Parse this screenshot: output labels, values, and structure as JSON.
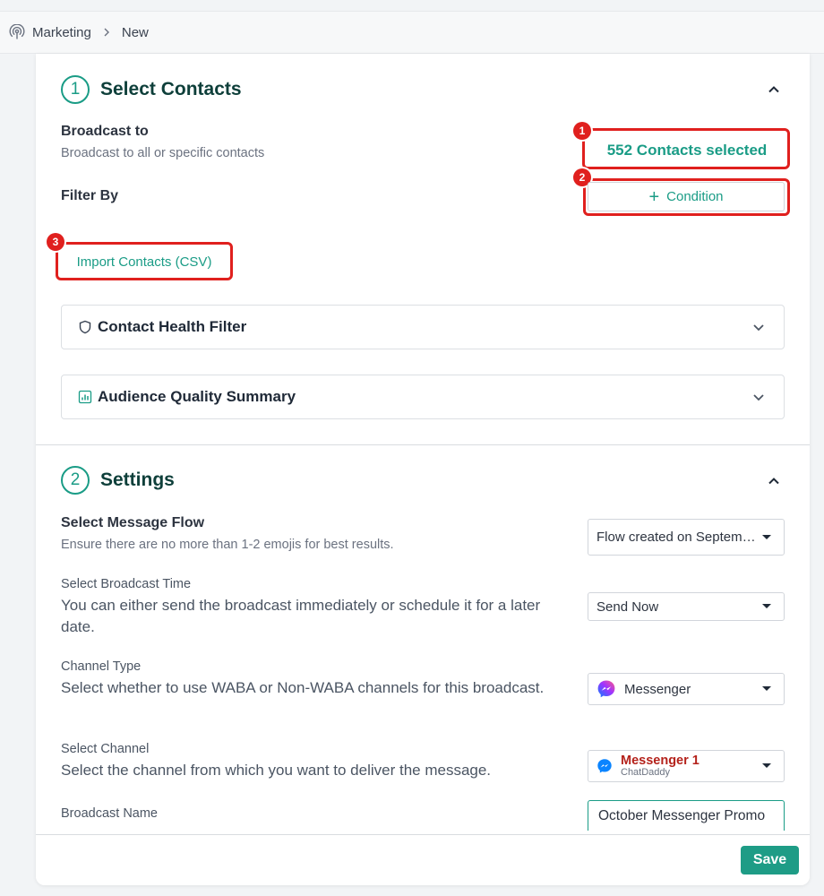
{
  "breadcrumb": {
    "items": [
      "Marketing",
      "New"
    ],
    "icon": "broadcast-icon"
  },
  "select_contacts": {
    "step": "1",
    "title": "Select Contacts",
    "broadcast_to_label": "Broadcast to",
    "broadcast_to_desc": "Broadcast to all or specific contacts",
    "contacts_selected": "552 Contacts selected",
    "filter_by_label": "Filter By",
    "condition_button": "Condition",
    "import_button": "Import Contacts (CSV)",
    "health_filter": "Contact Health Filter",
    "quality_summary": "Audience Quality Summary"
  },
  "annotations": {
    "badges": [
      "1",
      "2",
      "3"
    ],
    "color": "#e0201e"
  },
  "settings": {
    "step": "2",
    "title": "Settings",
    "message_flow": {
      "label": "Select Message Flow",
      "desc": "Ensure there are no more than 1-2 emojis for best results.",
      "value": "Flow created on September"
    },
    "broadcast_time": {
      "label": "Select Broadcast Time",
      "desc": "You can either send the broadcast immediately or schedule it for a later date.",
      "value": "Send Now"
    },
    "channel_type": {
      "label": "Channel Type",
      "desc": "Select whether to use WABA or Non-WABA channels for this broadcast.",
      "value": "Messenger",
      "icon": "messenger-icon"
    },
    "channel": {
      "label": "Select Channel",
      "desc": "Select the channel from which you want to deliver the message.",
      "value": "Messenger 1",
      "sub": "ChatDaddy",
      "icon": "messenger-icon"
    },
    "broadcast_name": {
      "label": "Broadcast Name",
      "value": "October Messenger Promo"
    }
  },
  "footer": {
    "save_label": "Save"
  },
  "colors": {
    "accent": "#1a9c86",
    "title": "#0e3f3a",
    "danger": "#e0201e"
  }
}
